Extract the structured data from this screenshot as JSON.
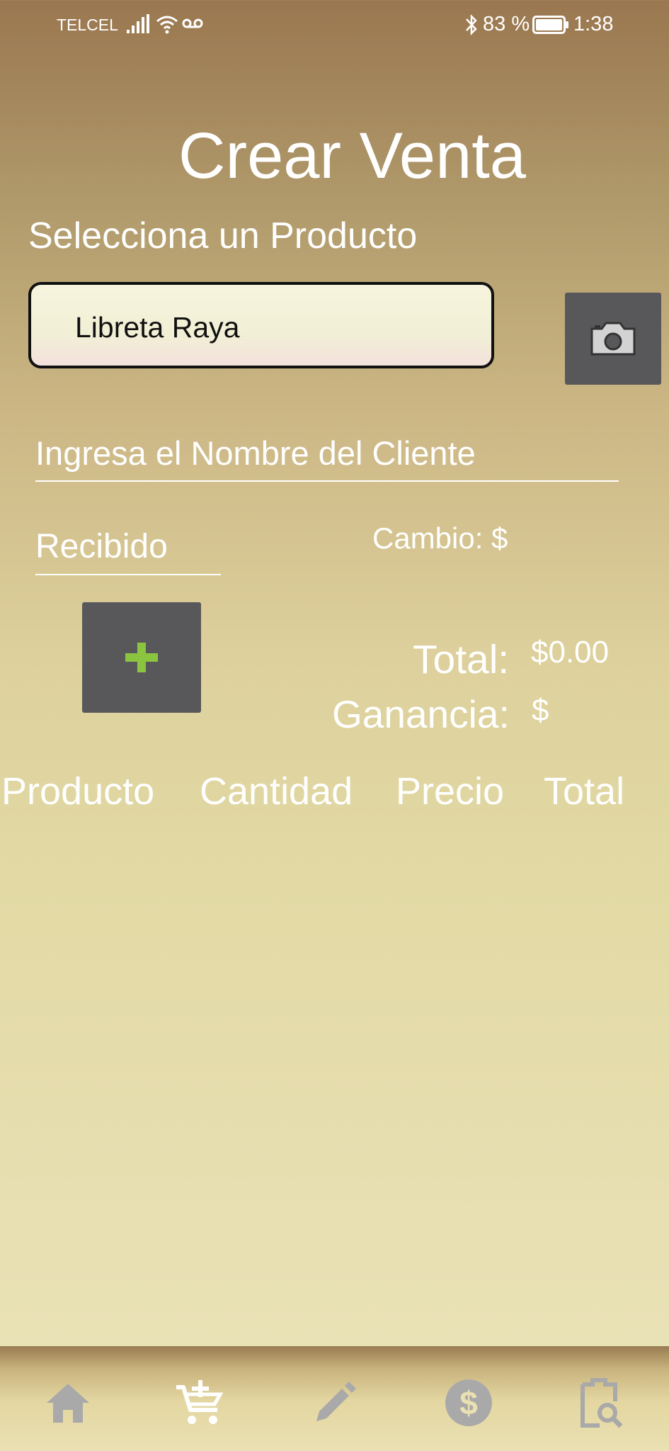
{
  "status_bar": {
    "carrier": "TELCEL",
    "battery": "83 %",
    "time": "1:38",
    "icons": [
      "signal-icon",
      "wifi-icon",
      "voicemail-icon",
      "bluetooth-icon",
      "battery-icon"
    ]
  },
  "page": {
    "title": "Crear Venta"
  },
  "product": {
    "label": "Selecciona un Producto",
    "selected": "Libreta Raya"
  },
  "client": {
    "placeholder": "Ingresa el Nombre del Cliente"
  },
  "payment": {
    "received_placeholder": "Recibido",
    "change_label": "Cambio: $"
  },
  "summary": {
    "total_label": "Total:",
    "total_value": "$0.00",
    "profit_label": "Ganancia:",
    "profit_value": "$"
  },
  "table": {
    "columns": [
      "Producto",
      "Cantidad",
      "Precio",
      "Total"
    ]
  },
  "nav": {
    "items": [
      {
        "icon": "home-icon",
        "active": false
      },
      {
        "icon": "add-cart-icon",
        "active": true
      },
      {
        "icon": "pencil-icon",
        "active": false
      },
      {
        "icon": "dollar-icon",
        "active": false
      },
      {
        "icon": "clipboard-search-icon",
        "active": false
      }
    ]
  },
  "colors": {
    "button_bg": "#58585a",
    "plus_green": "#8bc53f",
    "nav_inactive": "#a9a9a9",
    "nav_active": "#ffffff",
    "text": "#ffffff"
  }
}
